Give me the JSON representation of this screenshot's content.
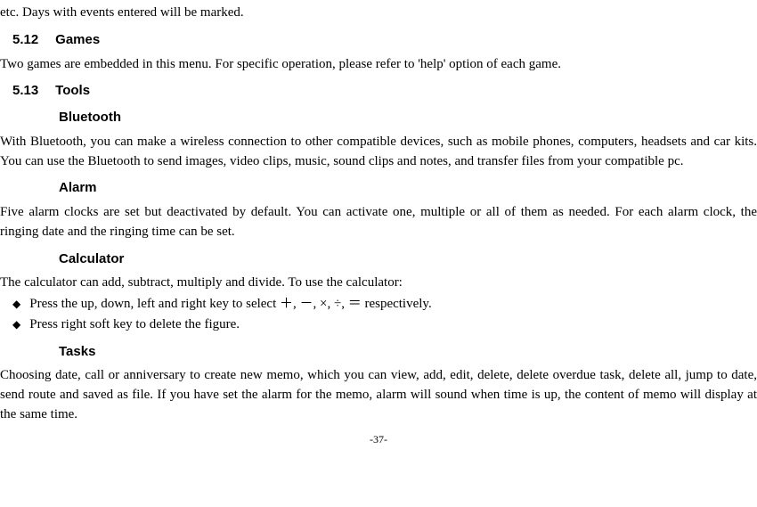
{
  "doc": {
    "orphan_line": "etc. Days with events entered will be marked.",
    "s512": {
      "num": "5.12",
      "title": "Games",
      "body": "Two games are embedded in this menu. For specific operation, please refer to 'help' option of each game."
    },
    "s513": {
      "num": "5.13",
      "title": "Tools",
      "bluetooth": {
        "title": "Bluetooth",
        "body": "With Bluetooth, you can make a wireless connection to other compatible devices, such as mobile phones, computers, headsets and car kits. You can use the Bluetooth to send images, video clips, music, sound clips and notes, and transfer files from your compatible pc."
      },
      "alarm": {
        "title": "Alarm",
        "body": "Five alarm clocks are set but deactivated by default. You can activate one, multiple or all of them as needed. For each alarm clock, the ringing date and the ringing time can be set."
      },
      "calculator": {
        "title": "Calculator",
        "intro": "The calculator can add, subtract, multiply and divide. To use the calculator:",
        "bullets": [
          "Press the up, down, left and right key to select ＋, －, ×, ÷, ＝ respectively.",
          "Press right soft key to delete the figure."
        ]
      },
      "tasks": {
        "title": "Tasks",
        "body": "Choosing date, call or anniversary to create new memo, which you can view, add, edit, delete, delete overdue task, delete all, jump to date, send route and saved as file. If you have set the alarm for the memo, alarm will sound when time is up, the content of memo will display at the same time."
      }
    },
    "page_number": "-37-"
  }
}
